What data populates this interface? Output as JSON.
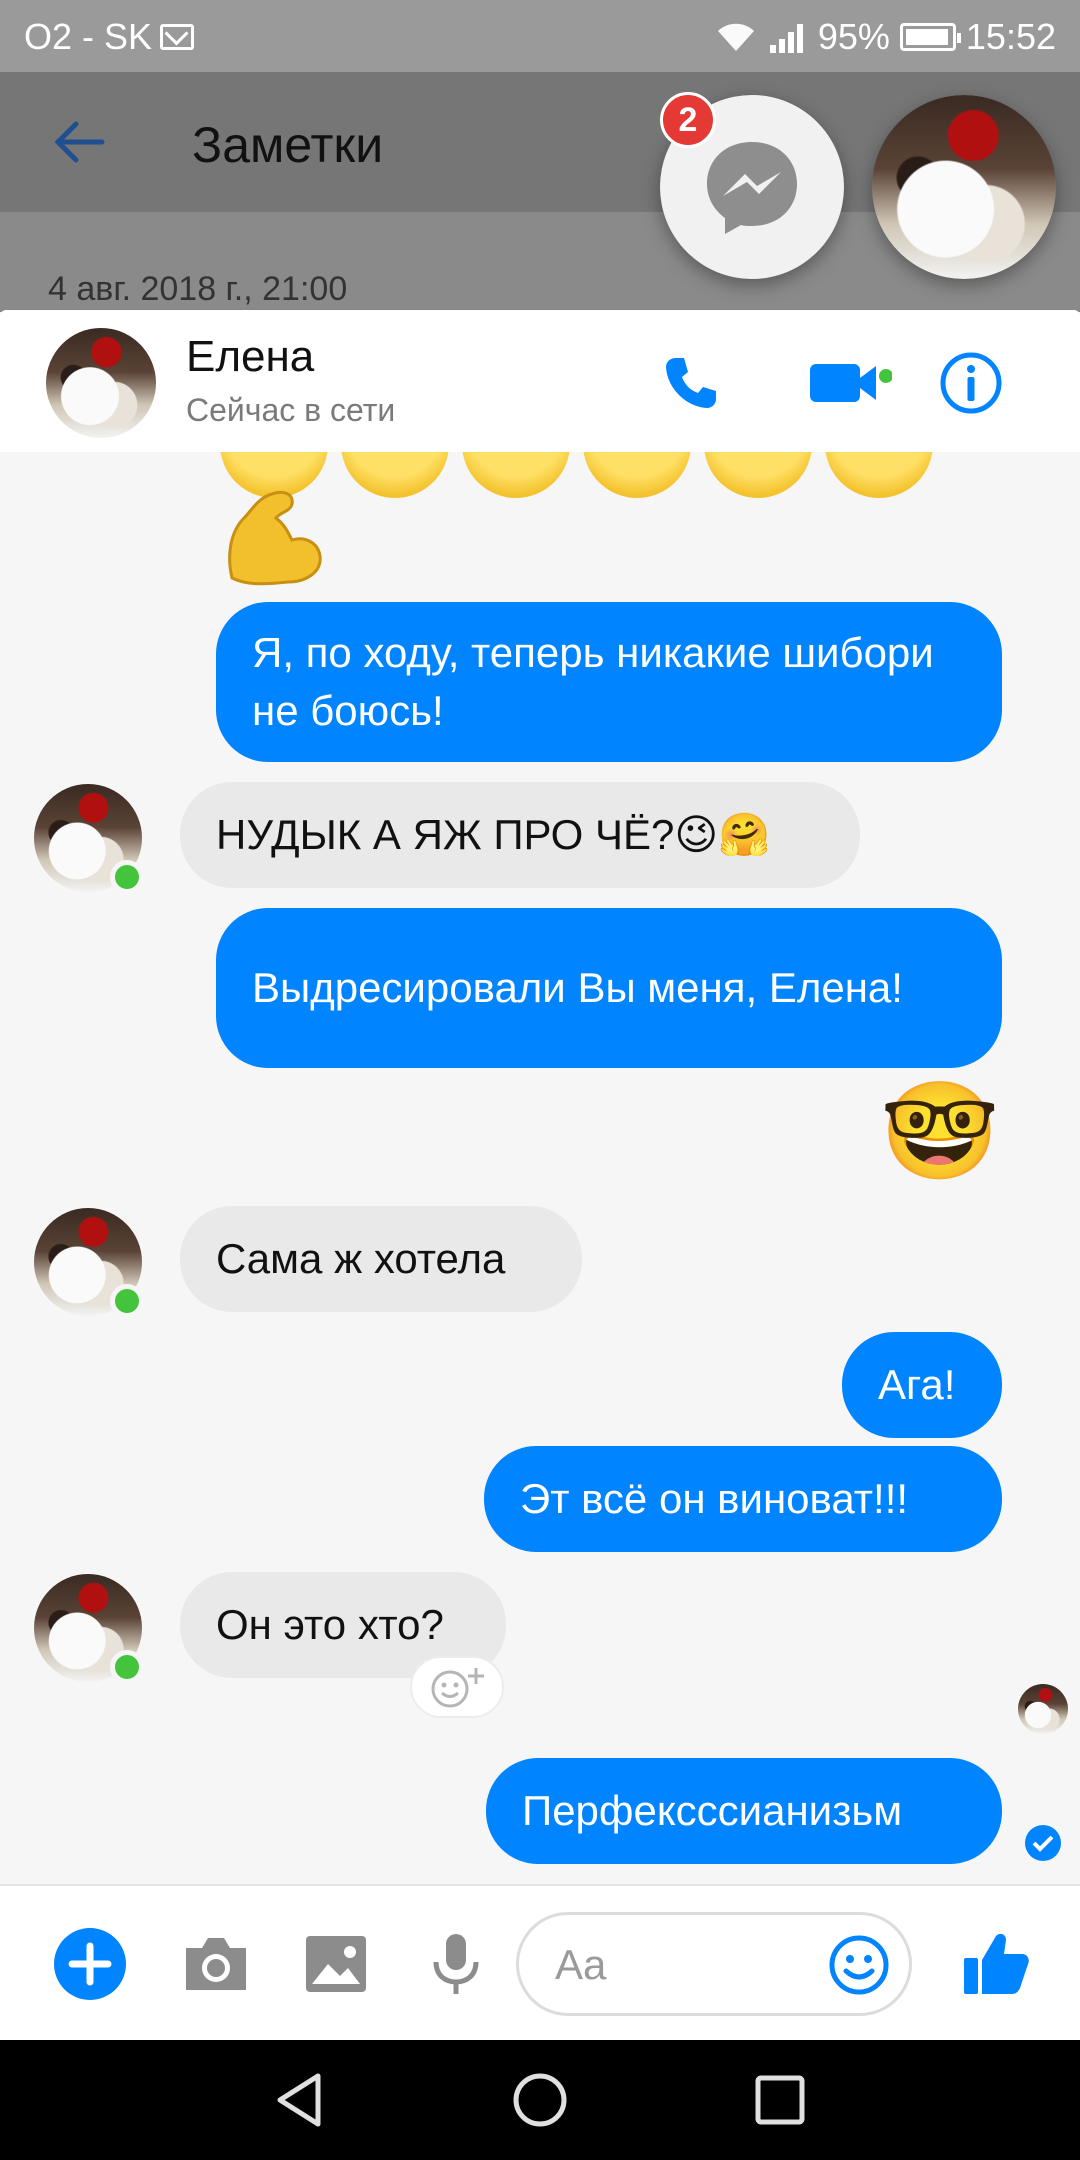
{
  "status_bar": {
    "carrier": "O2 - SK",
    "battery": "95%",
    "time": "15:52"
  },
  "notes_app": {
    "title": "Заметки",
    "date": "4 авг. 2018 г., 21:00"
  },
  "chat_heads": {
    "unread_count": "2"
  },
  "chat_header": {
    "name": "Елена",
    "status": "Сейчас в сети"
  },
  "messages": [
    {
      "from": "me",
      "text": "Я, по ходу, теперь никакие шибори не боюсь!"
    },
    {
      "from": "contact",
      "text": "НУДЫК А ЯЖ ПРО ЧЁ?😉🤗"
    },
    {
      "from": "me",
      "text": "Выдресировали Вы меня, Елена!"
    },
    {
      "from": "me",
      "emoji": "🤓"
    },
    {
      "from": "contact",
      "text": "Сама ж хотела"
    },
    {
      "from": "me",
      "text": "Ага!"
    },
    {
      "from": "me",
      "text": "Эт всё он виноват!!!"
    },
    {
      "from": "contact",
      "text": "Он это хто?"
    },
    {
      "from": "me",
      "text": "Перфексссианизьм"
    }
  ],
  "composer": {
    "placeholder": "Aa"
  },
  "colors": {
    "accent": "#0084ff",
    "online": "#44c43c",
    "badge": "#e53935"
  },
  "icons": {
    "back": "arrow-left-icon",
    "messenger": "messenger-icon",
    "call": "phone-icon",
    "video": "video-icon",
    "info": "info-icon",
    "add": "plus-icon",
    "camera": "camera-icon",
    "gallery": "image-icon",
    "mic": "microphone-icon",
    "emoji": "smiley-icon",
    "like": "thumbs-up-icon",
    "react": "add-reaction-icon",
    "seen": "check-circle-icon"
  }
}
